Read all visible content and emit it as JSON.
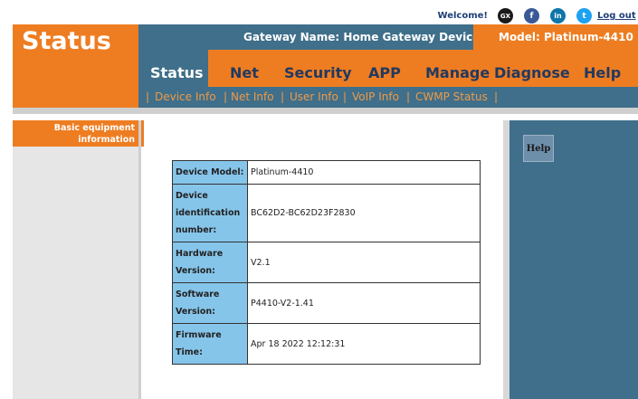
{
  "topbar": {
    "welcome": "Welcome!",
    "social": [
      {
        "name": "gx-icon",
        "glyph": "GX"
      },
      {
        "name": "facebook-icon",
        "glyph": "f"
      },
      {
        "name": "linkedin-icon",
        "glyph": "in"
      },
      {
        "name": "twitter-icon",
        "glyph": "t"
      }
    ],
    "logout": "Log out"
  },
  "brand": {
    "section_title": "Status"
  },
  "header": {
    "gateway_name": "Gateway Name: Home Gateway Device (CPE)",
    "model": "Model: Platinum-4410"
  },
  "nav": {
    "items": [
      {
        "label": "Status",
        "active": true
      },
      {
        "label": "Net"
      },
      {
        "label": "Security"
      },
      {
        "label": "APP"
      },
      {
        "label": "Manage"
      },
      {
        "label": "Diagnose"
      },
      {
        "label": "Help"
      }
    ]
  },
  "subnav": {
    "items": [
      "Device Info",
      "Net Info",
      "User Info",
      "VoIP Info",
      "CWMP Status"
    ]
  },
  "sidebar": {
    "active_item": "Basic equipment information"
  },
  "help": {
    "button_label": "Help"
  },
  "device_info": {
    "rows": [
      {
        "label": "Device Model:",
        "value": "Platinum-4410"
      },
      {
        "label": "Device identification number:",
        "value": "BC62D2-BC62D23F2830"
      },
      {
        "label": "Hardware Version:",
        "value": "V2.1"
      },
      {
        "label": "Software Version:",
        "value": "P4410-V2-1.41"
      },
      {
        "label": "Firmware Time:",
        "value": "Apr 18 2022 12:12:31"
      }
    ]
  },
  "colors": {
    "orange": "#ee7d22",
    "steel_blue": "#3f6f8a",
    "label_blue": "#86c5ea",
    "nav_text": "#22395f"
  }
}
